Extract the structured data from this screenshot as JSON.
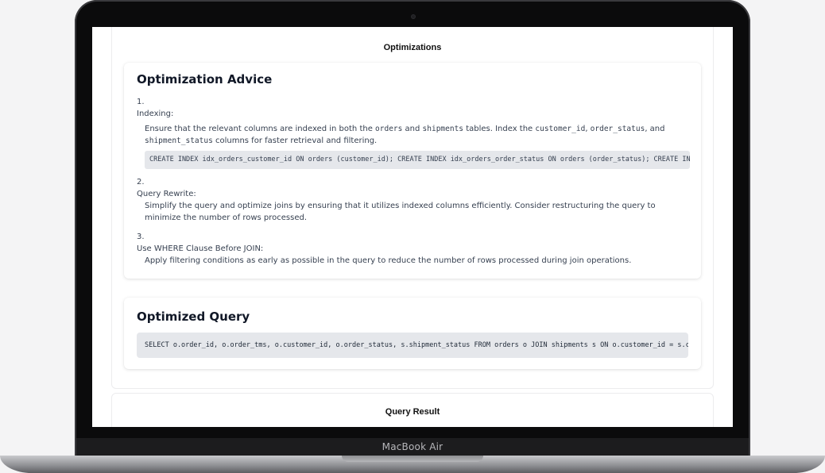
{
  "device": {
    "brand_label": "MacBook Air"
  },
  "optimizations": {
    "section_title": "Optimizations",
    "advice": {
      "heading": "Optimization Advice",
      "items": [
        {
          "number": "1.",
          "title": "Indexing:",
          "desc_parts": [
            "Ensure that the relevant columns are indexed in both the ",
            " and ",
            " tables. Index the ",
            ", ",
            ", and ",
            " columns for faster retrieval and filtering."
          ],
          "code_terms": [
            "orders",
            "shipments",
            "customer_id",
            "order_status",
            "shipment_status"
          ],
          "code": "CREATE INDEX idx_orders_customer_id ON orders (customer_id); CREATE INDEX idx_orders_order_status ON orders (order_status); CREATE INDEX idx_shipments_shipment_status ON shipments (shipment_status);"
        },
        {
          "number": "2.",
          "title": "Query Rewrite:",
          "desc": "Simplify the query and optimize joins by ensuring that it utilizes indexed columns efficiently. Consider restructuring the query to minimize the number of rows processed."
        },
        {
          "number": "3.",
          "title": "Use WHERE Clause Before JOIN:",
          "desc": "Apply filtering conditions as early as possible in the query to reduce the number of rows processed during join operations."
        }
      ]
    },
    "optimized_query": {
      "heading": "Optimized Query",
      "code": "SELECT o.order_id, o.order_tms, o.customer_id, o.order_status, s.shipment_status FROM orders o JOIN shipments s ON o.customer_id = s.customer_id"
    }
  },
  "query_result": {
    "section_title": "Query Result"
  }
}
